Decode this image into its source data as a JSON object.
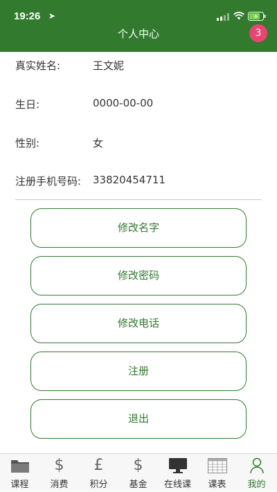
{
  "status": {
    "time": "19:26"
  },
  "header": {
    "title": "个人中心",
    "badge": "3"
  },
  "profile": {
    "name_label": "真实姓名:",
    "name_value": "王文妮",
    "birthday_label": "生日:",
    "birthday_value": "0000-00-00",
    "gender_label": "性别:",
    "gender_value": "女",
    "phone_label": "注册手机号码:",
    "phone_value": "33820454711"
  },
  "actions": {
    "edit_name": "修改名字",
    "edit_password": "修改密码",
    "edit_phone": "修改电话",
    "register": "注册",
    "logout": "退出"
  },
  "tabs": [
    {
      "label": "课程",
      "icon": "folder-icon"
    },
    {
      "label": "消费",
      "icon": "dollar-icon"
    },
    {
      "label": "积分",
      "icon": "pound-icon"
    },
    {
      "label": "基金",
      "icon": "dollar-icon"
    },
    {
      "label": "在线课",
      "icon": "monitor-icon"
    },
    {
      "label": "课表",
      "icon": "timetable-icon"
    },
    {
      "label": "我的",
      "icon": "person-icon"
    }
  ],
  "colors": {
    "primary": "#317a2e",
    "badge": "#e84670",
    "battery": "#7ad64a"
  }
}
